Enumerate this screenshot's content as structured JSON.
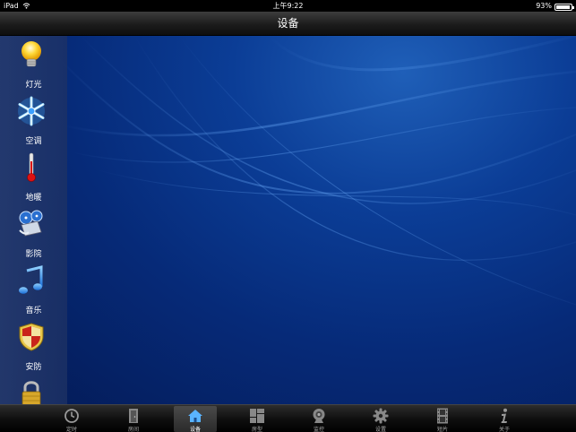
{
  "status_bar": {
    "device": "iPad",
    "time": "上午9:22",
    "battery": "93%",
    "battery_level": 0.93
  },
  "title_bar": {
    "title": "设备"
  },
  "sidebar": {
    "items": [
      {
        "label": "灯光",
        "icon": "light-bulb-icon"
      },
      {
        "label": "空调",
        "icon": "snowflake-icon"
      },
      {
        "label": "地暖",
        "icon": "thermometer-icon"
      },
      {
        "label": "影院",
        "icon": "film-reel-icon"
      },
      {
        "label": "音乐",
        "icon": "music-note-icon"
      },
      {
        "label": "安防",
        "icon": "shield-icon"
      },
      {
        "label": "",
        "icon": "padlock-icon"
      }
    ]
  },
  "tab_bar": {
    "active": "设备",
    "tabs": [
      {
        "label": "定时",
        "icon": "clock-icon"
      },
      {
        "label": "房间",
        "icon": "door-icon"
      },
      {
        "label": "设备",
        "icon": "house-icon"
      },
      {
        "label": "房型",
        "icon": "floorplan-icon"
      },
      {
        "label": "监控",
        "icon": "camera-icon"
      },
      {
        "label": "设置",
        "icon": "gear-icon"
      },
      {
        "label": "短片",
        "icon": "filmstrip-icon"
      },
      {
        "label": "关于",
        "icon": "info-icon"
      }
    ]
  },
  "colors": {
    "accent": "#0b3d96",
    "active_tab_icon": "#5ab4ff"
  }
}
